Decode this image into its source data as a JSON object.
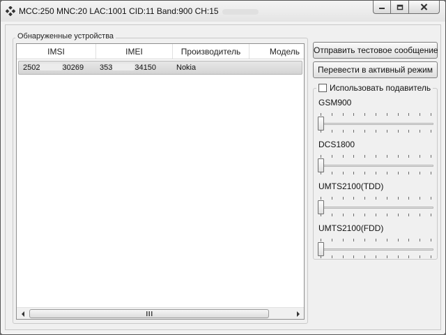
{
  "window": {
    "title": "MCC:250   MNC:20   LAC:1001   CID:11   Band:900   CH:15"
  },
  "devices_group": {
    "legend": "Обнаруженные устройства",
    "columns": {
      "imsi": "IMSI",
      "imei": "IMEI",
      "vendor": "Производитель",
      "model": "Модель"
    },
    "rows": [
      {
        "imsi_start": "2502",
        "imsi_end": "30269",
        "imei_start": "353",
        "imei_end": "34150",
        "vendor": "Nokia"
      }
    ]
  },
  "buttons": {
    "send_test": "Отправить тестовое сообщение",
    "activate": "Перевести в активный режим"
  },
  "jammer": {
    "label": "Использовать подавитель",
    "checked": false,
    "bands": [
      {
        "name": "GSM900",
        "level": 0
      },
      {
        "name": "DCS1800",
        "level": 0
      },
      {
        "name": "UMTS2100(TDD)",
        "level": 0
      },
      {
        "name": "UMTS2100(FDD)",
        "level": 0
      }
    ]
  },
  "icons": {
    "app": "app-diamond-icon",
    "minimize": "minimize-icon",
    "maximize": "maximize-icon",
    "close": "close-icon",
    "scroll_left": "scroll-left-arrow-icon",
    "scroll_right": "scroll-right-arrow-icon",
    "grip": "scroll-grip-icon"
  }
}
